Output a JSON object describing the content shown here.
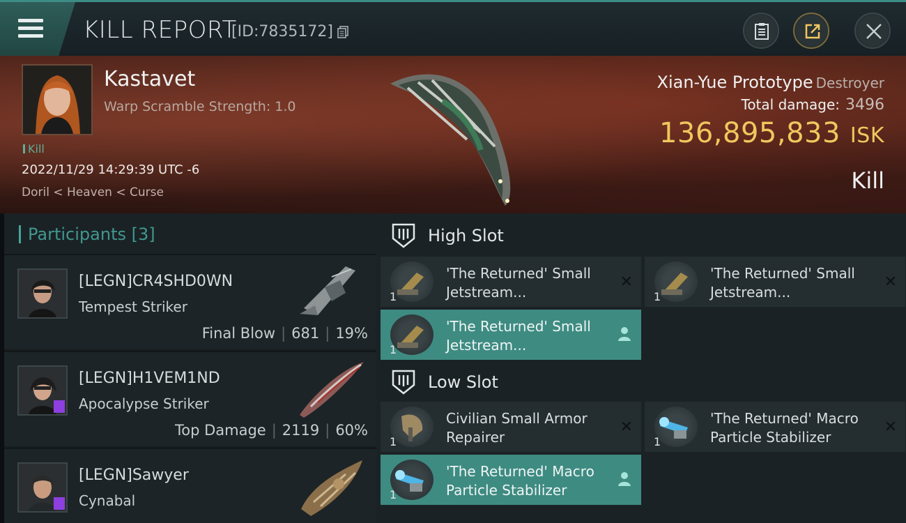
{
  "header": {
    "title": "KILL REPORT",
    "report_id": "[ID:7835172]"
  },
  "victim": {
    "name": "Kastavet",
    "warp_scramble": "Warp Scramble Strength: 1.0",
    "kill_tag": "Kill",
    "datetime": "2022/11/29 14:29:39 UTC -6",
    "location": "Doril < Heaven < Curse",
    "ship_name": "Xian-Yue Prototype",
    "ship_class": "Destroyer",
    "total_damage_label": "Total damage:",
    "total_damage_value": "3496",
    "isk_value": "136,895,833",
    "isk_unit": "ISK",
    "result": "Kill"
  },
  "participants": {
    "label": "Participants",
    "count": "[3]",
    "rows": [
      {
        "name": "[LEGN]CR4SHD0WN",
        "ship": "Tempest Striker",
        "stat_label": "Final Blow",
        "damage": "681",
        "percent": "19%"
      },
      {
        "name": "[LEGN]H1VEM1ND",
        "ship": "Apocalypse Striker",
        "stat_label": "Top Damage",
        "damage": "2119",
        "percent": "60%"
      },
      {
        "name": "[LEGN]Sawyer",
        "ship": "Cynabal"
      }
    ]
  },
  "fitting": {
    "high_slot": {
      "title": "High Slot",
      "modules": [
        {
          "line1": "'The Returned' Small",
          "line2": "Jetstream...",
          "qty": "1",
          "state": "destroyed"
        },
        {
          "line1": "'The Returned' Small",
          "line2": "Jetstream...",
          "qty": "1",
          "state": "destroyed"
        },
        {
          "line1": "'The Returned' Small",
          "line2": "Jetstream...",
          "qty": "1",
          "state": "dropped"
        }
      ]
    },
    "low_slot": {
      "title": "Low Slot",
      "modules": [
        {
          "line1": "Civilian Small Armor",
          "line2": "Repairer",
          "qty": "1",
          "state": "destroyed"
        },
        {
          "line1": "'The Returned' Macro",
          "line2": "Particle Stabilizer",
          "qty": "1",
          "state": "destroyed"
        },
        {
          "line1": "'The Returned' Macro",
          "line2": "Particle Stabilizer",
          "qty": "1",
          "state": "dropped"
        }
      ]
    }
  },
  "colors": {
    "accent_teal": "#3e8b82",
    "isk_gold": "#f0c85e",
    "corp_badge": "#8d3fe0"
  }
}
